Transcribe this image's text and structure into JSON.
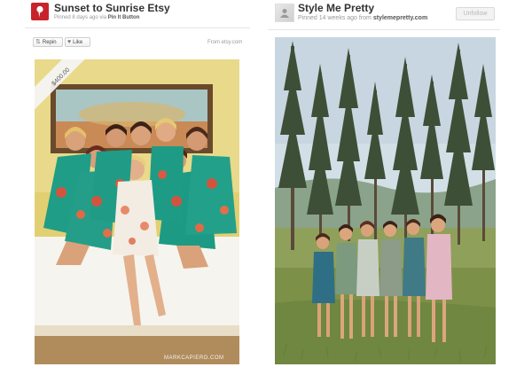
{
  "left_pin": {
    "title": "Sunset to Sunrise Etsy",
    "meta_prefix": "Pinned 8 days ago via",
    "meta_via": "Pin It Button",
    "repin_label": "Repin",
    "like_label": "Like",
    "source": "From etsy.com",
    "price_tag": "$400.00",
    "watermark": "MARKCAPIERO.COM",
    "icons": [
      "pin-board-icon",
      "repin-icon",
      "heart-icon"
    ],
    "accent_color": "#c8232c"
  },
  "right_pin": {
    "user": "Style Me Pretty",
    "meta_prefix": "Pinned 14 weeks ago from",
    "meta_source": "stylemepretty.com",
    "unfollow_label": "Unfollow",
    "icons": [
      "user-avatar-icon"
    ]
  }
}
